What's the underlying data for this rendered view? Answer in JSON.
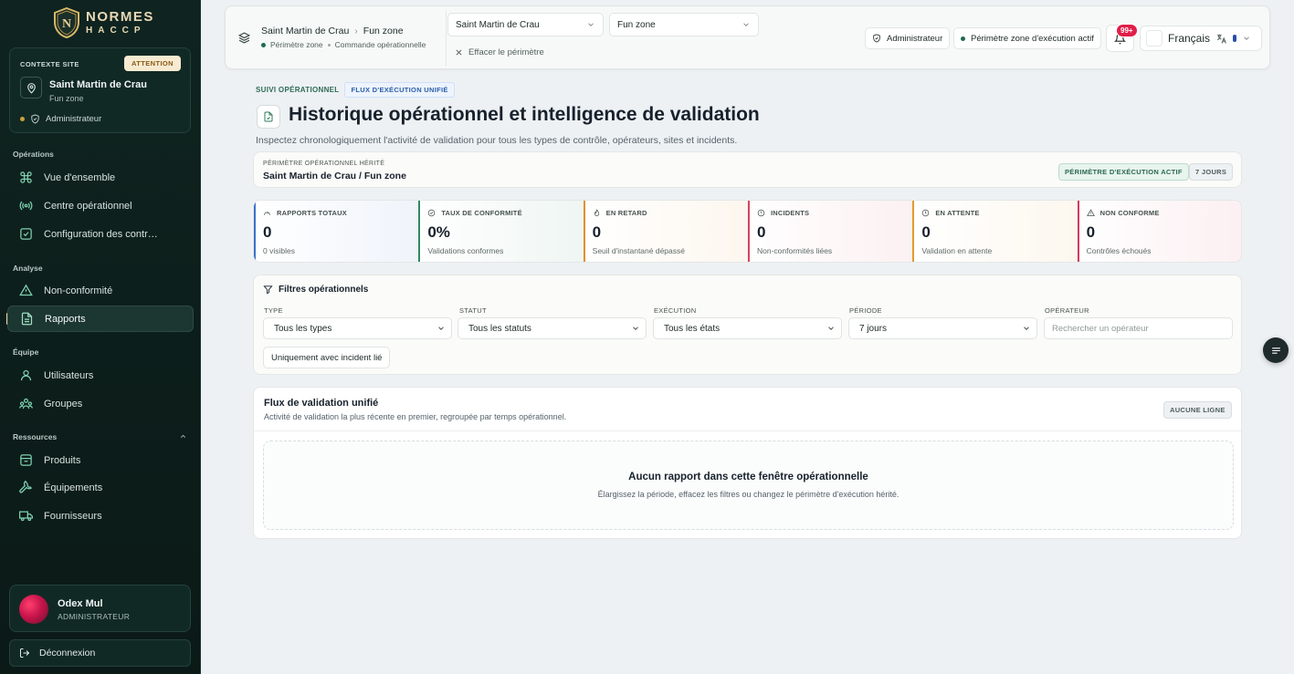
{
  "brand": {
    "line1": "NORMES",
    "line2": "HACCP"
  },
  "sidebar": {
    "context": {
      "label": "CONTEXTE SITE",
      "badge": "ATTENTION",
      "site": "Saint Martin de Crau",
      "zone": "Fun zone",
      "role": "Administrateur"
    },
    "sections": {
      "operations": "Opérations",
      "analyse": "Analyse",
      "equipe": "Équipe",
      "ressources": "Ressources"
    },
    "items": {
      "overview": "Vue d'ensemble",
      "ops_center": "Centre opérationnel",
      "controls_config": "Configuration des contr…",
      "non_conformity": "Non-conformité",
      "reports": "Rapports",
      "users": "Utilisateurs",
      "groups": "Groupes",
      "products": "Produits",
      "equipment": "Équipements",
      "suppliers": "Fournisseurs"
    },
    "user": {
      "name": "Odex Mul",
      "role": "ADMINISTRATEUR"
    },
    "logout": "Déconnexion"
  },
  "topbar": {
    "crumb_site": "Saint Martin de Crau",
    "crumb_zone": "Fun zone",
    "sub_scope": "Périmètre zone",
    "sub_command": "Commande opérationnelle",
    "select_site": "Saint Martin de Crau",
    "select_zone": "Fun zone",
    "clear": "Effacer le périmètre",
    "role_pill": "Administrateur",
    "scope_pill": "Périmètre zone d'exécution actif",
    "notif_count": "99+",
    "language": "Français"
  },
  "header": {
    "eyebrow": "SUIVI OPÉRATIONNEL",
    "eyebrow_tag": "FLUX D'EXÉCUTION UNIFIÉ",
    "title": "Historique opérationnel et intelligence de validation",
    "description": "Inspectez chronologiquement l'activité de validation pour tous les types de contrôle, opérateurs, sites et incidents."
  },
  "scope": {
    "label": "PÉRIMÈTRE OPÉRATIONNEL HÉRITÉ",
    "value": "Saint Martin de Crau / Fun zone",
    "tag_active": "PÉRIMÈTRE D'EXÉCUTION ACTIF",
    "tag_days": "7 JOURS"
  },
  "stats": [
    {
      "label": "RAPPORTS TOTAUX",
      "value": "0",
      "sub": "0 visibles",
      "color": "#3b73c9"
    },
    {
      "label": "TAUX DE CONFORMITÉ",
      "value": "0%",
      "sub": "Validations conformes",
      "color": "#2f8a5f"
    },
    {
      "label": "EN RETARD",
      "value": "0",
      "sub": "Seuil d'instantané dépassé",
      "color": "#e0922f"
    },
    {
      "label": "INCIDENTS",
      "value": "0",
      "sub": "Non-conformités liées",
      "color": "#d64560"
    },
    {
      "label": "EN ATTENTE",
      "value": "0",
      "sub": "Validation en attente",
      "color": "#e39a2e"
    },
    {
      "label": "NON CONFORME",
      "value": "0",
      "sub": "Contrôles échoués",
      "color": "#d93a5c"
    }
  ],
  "filters": {
    "title": "Filtres opérationnels",
    "type_label": "TYPE",
    "type_value": "Tous les types",
    "status_label": "STATUT",
    "status_value": "Tous les statuts",
    "exec_label": "EXÉCUTION",
    "exec_value": "Tous les états",
    "period_label": "PÉRIODE",
    "period_value": "7 jours",
    "operator_label": "OPÉRATEUR",
    "operator_placeholder": "Rechercher un opérateur",
    "incident_button": "Uniquement avec incident lié"
  },
  "flux": {
    "title": "Flux de validation unifié",
    "subtitle": "Activité de validation la plus récente en premier, regroupée par temps opérationnel.",
    "tag": "AUCUNE LIGNE",
    "empty_title": "Aucun rapport dans cette fenêtre opérationnelle",
    "empty_sub": "Élargissez la période, effacez les filtres ou changez le périmètre d'exécution hérité."
  }
}
